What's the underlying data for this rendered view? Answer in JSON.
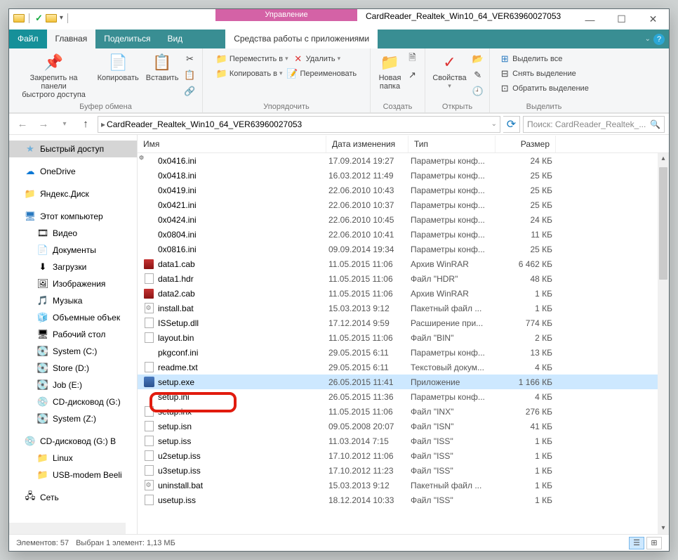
{
  "title": "CardReader_Realtek_Win10_64_VER63960027053",
  "manage_label": "Управление",
  "tabs": {
    "file": "Файл",
    "home": "Главная",
    "share": "Поделиться",
    "view": "Вид",
    "apptools": "Средства работы с приложениями"
  },
  "ribbon": {
    "pin": "Закрепить на панели\nбыстрого доступа",
    "copy": "Копировать",
    "paste": "Вставить",
    "clipboard_group": "Буфер обмена",
    "moveto": "Переместить в",
    "copyto": "Копировать в",
    "delete": "Удалить",
    "rename": "Переименовать",
    "organize_group": "Упорядочить",
    "newfolder": "Новая\nпапка",
    "new_group": "Создать",
    "properties": "Свойства",
    "open_group": "Открыть",
    "selectall": "Выделить все",
    "selectnone": "Снять выделение",
    "invertsel": "Обратить выделение",
    "select_group": "Выделить",
    "cut_i": "✂",
    "newitem_i": "🗎",
    "easy_i": "📋"
  },
  "breadcrumb": {
    "path": "CardReader_Realtek_Win10_64_VER63960027053"
  },
  "search_placeholder": "Поиск: CardReader_Realtek_...",
  "columns": {
    "name": "Имя",
    "date": "Дата изменения",
    "type": "Тип",
    "size": "Размер"
  },
  "nav": {
    "quick": "Быстрый доступ",
    "onedrive": "OneDrive",
    "yadisk": "Яндекс.Диск",
    "thispc": "Этот компьютер",
    "videos": "Видео",
    "documents": "Документы",
    "downloads": "Загрузки",
    "pictures": "Изображения",
    "music": "Музыка",
    "objects3d": "Объемные объек",
    "desktop": "Рабочий стол",
    "sysc": "System (C:)",
    "stored": "Store (D:)",
    "jobe": "Job (E:)",
    "cdg": "CD-дисковод (G:)",
    "sysz": "System (Z:)",
    "cdgb": "CD-дисковод (G:) В",
    "linux": "Linux",
    "usbmodem": "USB-modem Beeli",
    "network": "Сеть"
  },
  "files": [
    {
      "icon": "ini",
      "name": "0x0416.ini",
      "date": "17.09.2014 19:27",
      "type": "Параметры конф...",
      "size": "24 КБ"
    },
    {
      "icon": "ini",
      "name": "0x0418.ini",
      "date": "16.03.2012 11:49",
      "type": "Параметры конф...",
      "size": "25 КБ"
    },
    {
      "icon": "ini",
      "name": "0x0419.ini",
      "date": "22.06.2010 10:43",
      "type": "Параметры конф...",
      "size": "25 КБ"
    },
    {
      "icon": "ini",
      "name": "0x0421.ini",
      "date": "22.06.2010 10:37",
      "type": "Параметры конф...",
      "size": "25 КБ"
    },
    {
      "icon": "ini",
      "name": "0x0424.ini",
      "date": "22.06.2010 10:45",
      "type": "Параметры конф...",
      "size": "24 КБ"
    },
    {
      "icon": "ini",
      "name": "0x0804.ini",
      "date": "22.06.2010 10:41",
      "type": "Параметры конф...",
      "size": "11 КБ"
    },
    {
      "icon": "ini",
      "name": "0x0816.ini",
      "date": "09.09.2014 19:34",
      "type": "Параметры конф...",
      "size": "25 КБ"
    },
    {
      "icon": "cab",
      "name": "data1.cab",
      "date": "11.05.2015 11:06",
      "type": "Архив WinRAR",
      "size": "6 462 КБ"
    },
    {
      "icon": "gen",
      "name": "data1.hdr",
      "date": "11.05.2015 11:06",
      "type": "Файл \"HDR\"",
      "size": "48 КБ"
    },
    {
      "icon": "cab",
      "name": "data2.cab",
      "date": "11.05.2015 11:06",
      "type": "Архив WinRAR",
      "size": "1 КБ"
    },
    {
      "icon": "bat",
      "name": "install.bat",
      "date": "15.03.2013 9:12",
      "type": "Пакетный файл ...",
      "size": "1 КБ"
    },
    {
      "icon": "gen",
      "name": "ISSetup.dll",
      "date": "17.12.2014 9:59",
      "type": "Расширение при...",
      "size": "774 КБ"
    },
    {
      "icon": "gen",
      "name": "layout.bin",
      "date": "11.05.2015 11:06",
      "type": "Файл \"BIN\"",
      "size": "2 КБ"
    },
    {
      "icon": "ini",
      "name": "pkgconf.ini",
      "date": "29.05.2015 6:11",
      "type": "Параметры конф...",
      "size": "13 КБ"
    },
    {
      "icon": "gen",
      "name": "readme.txt",
      "date": "29.05.2015 6:11",
      "type": "Текстовый докум...",
      "size": "4 КБ"
    },
    {
      "icon": "exe",
      "name": "setup.exe",
      "date": "26.05.2015 11:41",
      "type": "Приложение",
      "size": "1 166 КБ",
      "selected": true
    },
    {
      "icon": "ini",
      "name": "setup.ini",
      "date": "26.05.2015 11:36",
      "type": "Параметры конф...",
      "size": "4 КБ"
    },
    {
      "icon": "gen",
      "name": "setup.inx",
      "date": "11.05.2015 11:06",
      "type": "Файл \"INX\"",
      "size": "276 КБ"
    },
    {
      "icon": "gen",
      "name": "setup.isn",
      "date": "09.05.2008 20:07",
      "type": "Файл \"ISN\"",
      "size": "41 КБ"
    },
    {
      "icon": "gen",
      "name": "setup.iss",
      "date": "11.03.2014 7:15",
      "type": "Файл \"ISS\"",
      "size": "1 КБ"
    },
    {
      "icon": "gen",
      "name": "u2setup.iss",
      "date": "17.10.2012 11:06",
      "type": "Файл \"ISS\"",
      "size": "1 КБ"
    },
    {
      "icon": "gen",
      "name": "u3setup.iss",
      "date": "17.10.2012 11:23",
      "type": "Файл \"ISS\"",
      "size": "1 КБ"
    },
    {
      "icon": "bat",
      "name": "uninstall.bat",
      "date": "15.03.2013 9:12",
      "type": "Пакетный файл ...",
      "size": "1 КБ"
    },
    {
      "icon": "gen",
      "name": "usetup.iss",
      "date": "18.12.2014 10:33",
      "type": "Файл \"ISS\"",
      "size": "1 КБ"
    }
  ],
  "status": {
    "count": "Элементов: 57",
    "selected": "Выбран 1 элемент: 1,13 МБ"
  }
}
